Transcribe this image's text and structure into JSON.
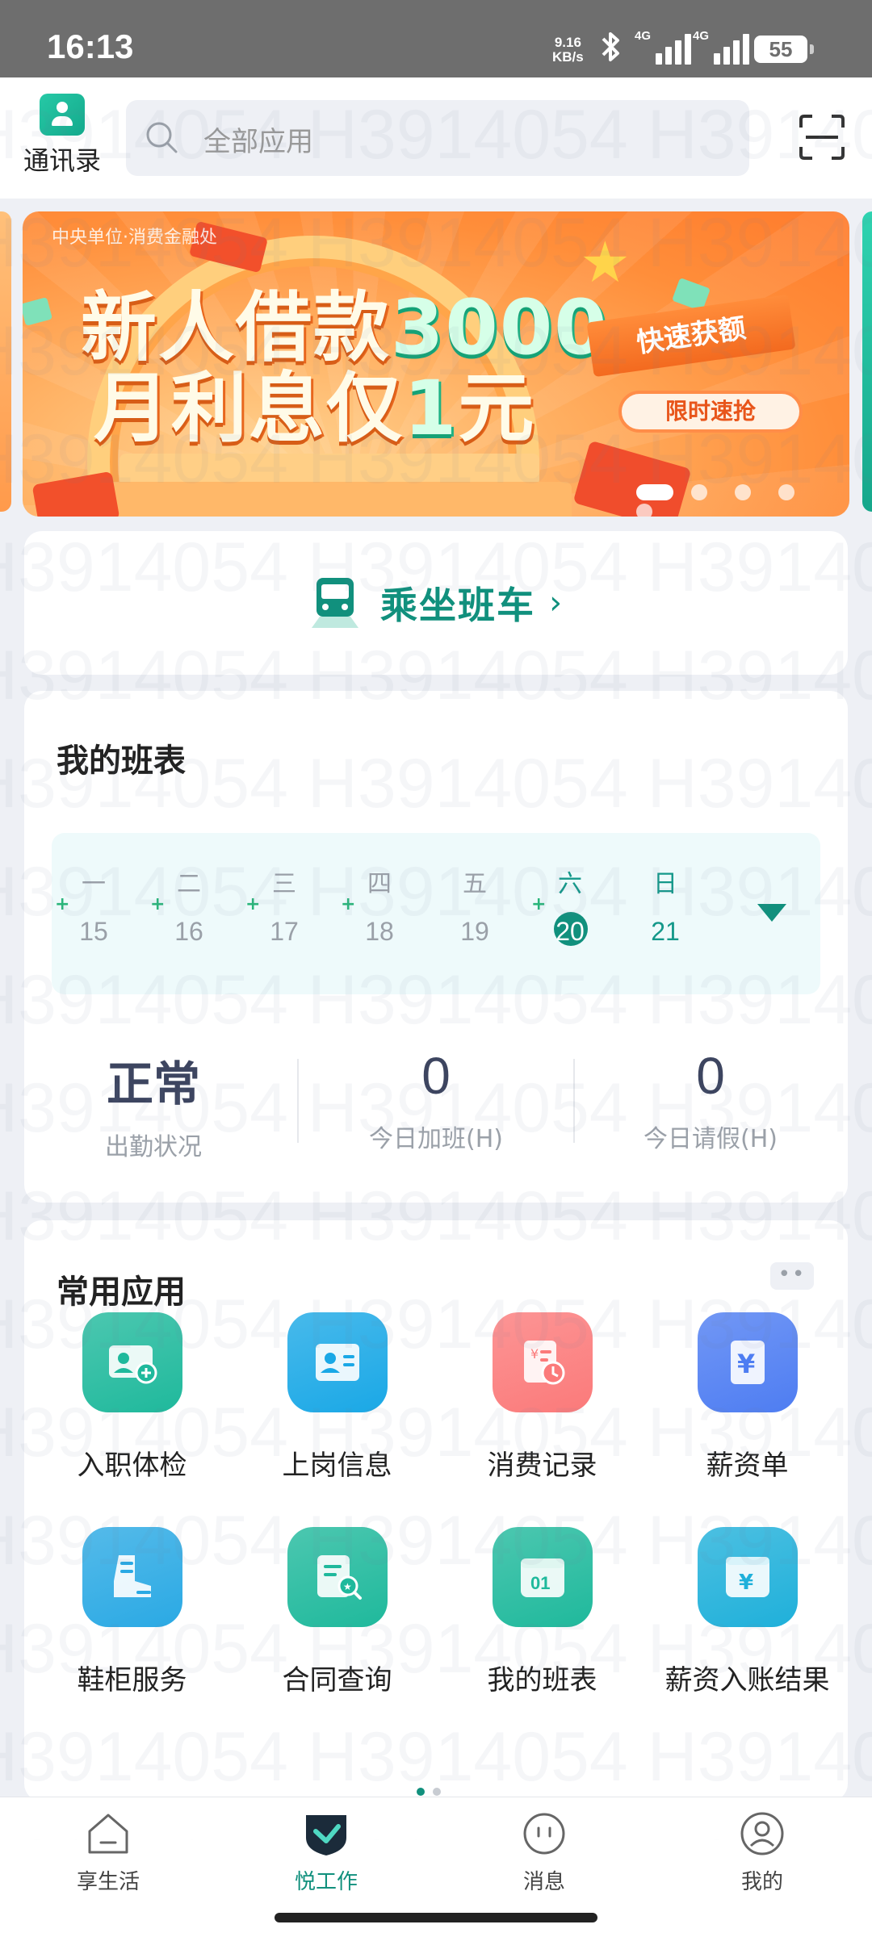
{
  "status_bar": {
    "time": "16:13",
    "net_speed_value": "9.16",
    "net_speed_unit": "KB/s",
    "signal1_label": "4G",
    "signal2_label": "4G",
    "battery": "55"
  },
  "header": {
    "contacts_label": "通讯录",
    "search_placeholder": "全部应用"
  },
  "banner": {
    "tag": "中央单位·消费金融处",
    "line1_prefix": "新人借款",
    "line1_number": "3000",
    "line2_prefix": "月利息仅",
    "line2_number": "1",
    "line2_suffix": "元",
    "ribbon": "快速获额",
    "button": "限时速抢",
    "slide_count": 5,
    "active_slide": 1
  },
  "bus": {
    "label": "乘坐班车",
    "chevron": "›"
  },
  "schedule": {
    "title": "我的班表",
    "days": [
      {
        "weekday": "一",
        "date": "15",
        "plus": "+"
      },
      {
        "weekday": "二",
        "date": "16",
        "plus": "+"
      },
      {
        "weekday": "三",
        "date": "17",
        "plus": "+"
      },
      {
        "weekday": "四",
        "date": "18",
        "plus": "+"
      },
      {
        "weekday": "五",
        "date": "19",
        "plus": ""
      },
      {
        "weekday": "六",
        "date": "20",
        "plus": "+"
      },
      {
        "weekday": "日",
        "date": "21",
        "plus": ""
      }
    ],
    "stats": [
      {
        "value": "正常",
        "label": "出勤状况"
      },
      {
        "value": "0",
        "label": "今日加班(H)"
      },
      {
        "value": "0",
        "label": "今日请假(H)"
      }
    ]
  },
  "apps": {
    "title": "常用应用",
    "more": "••",
    "items": [
      {
        "label": "入职体检",
        "icon": "medical-check-icon",
        "color": "#1fb99c"
      },
      {
        "label": "上岗信息",
        "icon": "id-card-icon",
        "color": "#1aa8e6"
      },
      {
        "label": "消费记录",
        "icon": "receipt-clock-icon",
        "color": "#fb7a7a"
      },
      {
        "label": "薪资单",
        "icon": "yen-document-icon",
        "color": "#4e7df2"
      },
      {
        "label": "鞋柜服务",
        "icon": "boot-icon",
        "color": "#2aa9e4"
      },
      {
        "label": "合同查询",
        "icon": "contract-search-icon",
        "color": "#1fb99c"
      },
      {
        "label": "我的班表",
        "icon": "calendar-icon",
        "color": "#1fb99c"
      },
      {
        "label": "薪资入账结果",
        "icon": "yen-wallet-icon",
        "color": "#1fb0da"
      }
    ],
    "page_count": 2,
    "active_page": 1
  },
  "bottom_nav": {
    "items": [
      {
        "label": "享生活",
        "icon": "home-icon"
      },
      {
        "label": "悦工作",
        "icon": "work-shield-icon"
      },
      {
        "label": "消息",
        "icon": "message-icon"
      },
      {
        "label": "我的",
        "icon": "profile-icon"
      }
    ],
    "active": 1
  },
  "watermark": "H3914054",
  "colors": {
    "accent": "#11907d",
    "bg": "#eef0f5",
    "status_bar": "#6e6e6e"
  }
}
